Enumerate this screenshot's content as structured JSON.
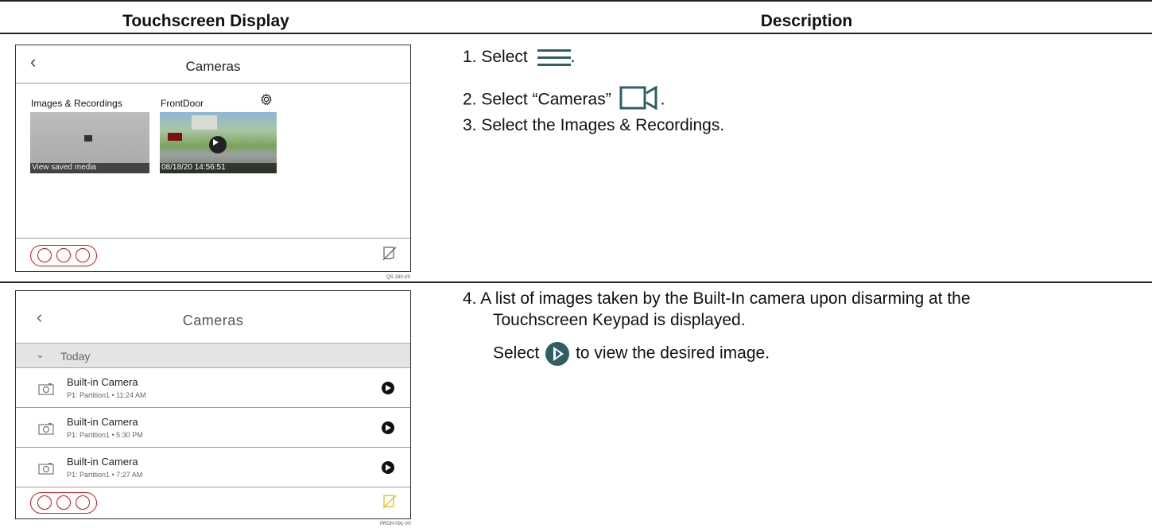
{
  "table": {
    "col1_header": "Touchscreen Display",
    "col2_header": "Description"
  },
  "screen1": {
    "title": "Cameras",
    "tile1_label": "Images & Recordings",
    "tile1_caption": "View saved media",
    "tile2_label": "FrontDoor",
    "tile2_caption": "08/18/20 14:56:51",
    "code": "QS-180-V0"
  },
  "screen2": {
    "title": "Cameras",
    "group_label": "Today",
    "rows": [
      {
        "title": "Built-in Camera",
        "sub": "P1: Partition1 • 11:24 AM"
      },
      {
        "title": "Built-in Camera",
        "sub": "P1: Partition1 • 5:30 PM"
      },
      {
        "title": "Built-in Camera",
        "sub": "P1: Partition1 • 7:27 AM"
      }
    ],
    "code": "PROH-091-V0"
  },
  "steps": {
    "s1_prefix": "1.  Select",
    "s1_suffix": ".",
    "s2_prefix": "2.  Select “Cameras”",
    "s2_suffix": ".",
    "s3": "3.  Select the Images & Recordings.",
    "s4_line1": "4.  A list of images taken by the Built-In camera upon disarming at the",
    "s4_line2": "Touchscreen Keypad is displayed.",
    "s4b_prefix": "Select",
    "s4b_suffix": "to view the desired image."
  },
  "colors": {
    "accent": "#2f5f63",
    "emergency": "#d0121b",
    "warning": "#e8b923"
  }
}
